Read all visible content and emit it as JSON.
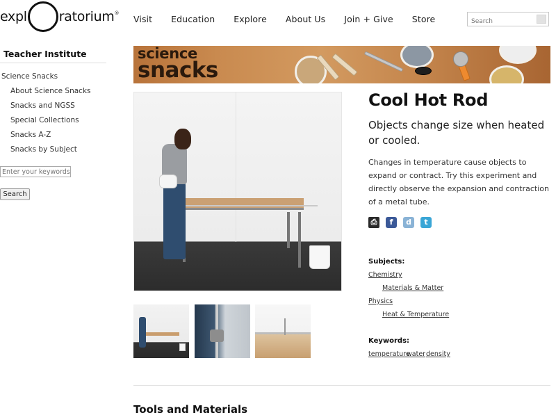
{
  "logo": {
    "text_left": "expl",
    "text_right": "ratorium",
    "tm": "®"
  },
  "nav": [
    "Visit",
    "Education",
    "Explore",
    "About Us",
    "Join + Give",
    "Store"
  ],
  "search": {
    "placeholder": "Search"
  },
  "sidebar": {
    "title": "Teacher Institute",
    "main_item": "Science Snacks",
    "items": [
      "About Science Snacks",
      "Snacks and NGSS",
      "Special Collections",
      "Snacks A-Z",
      "Snacks by Subject"
    ],
    "keyword_placeholder": "Enter your keywords",
    "search_button": "Search"
  },
  "banner": {
    "line1": "science",
    "line2": "snacks"
  },
  "snack": {
    "title": "Cool Hot Rod",
    "subtitle": "Objects change size when heated or cooled.",
    "description": "Changes in temperature cause objects to expand or contract. Try this experiment and directly observe the expansion and contraction of a metal tube."
  },
  "share_icons": [
    "print-icon",
    "facebook-icon",
    "digg-icon",
    "twitter-icon"
  ],
  "subjects": {
    "label": "Subjects:",
    "chemistry": "Chemistry",
    "materials": "Materials & Matter",
    "physics": "Physics",
    "heat": "Heat & Temperature"
  },
  "keywords": {
    "label": "Keywords:",
    "items": [
      "temperature",
      "water",
      "density"
    ]
  },
  "section": {
    "tools_title": "Tools and Materials"
  },
  "colors": {
    "banner": "#c98a4f",
    "text": "#222222",
    "facebook": "#3b5998",
    "twitter": "#3aa6d6"
  }
}
